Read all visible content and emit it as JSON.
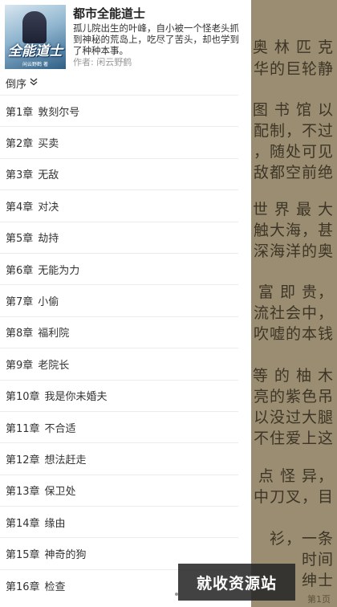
{
  "reader": {
    "lines": [
      "奥 林 匹 克",
      "华的巨轮静",
      "图 书 馆 以",
      "配制，不过",
      "，随处可见",
      "敌都空前绝",
      "世 界 最 大",
      "触大海，甚",
      "深海洋的奥",
      "富 即 贵，",
      "流社会中，",
      "吹嘘的本钱",
      "等 的 柚 木",
      "亮的紫色吊",
      "以没过大腿",
      "不住爱上这",
      "点 怪 异，",
      "中刀叉，目",
      "衫，一条",
      "时间",
      "绅士"
    ],
    "page_num": "第1页"
  },
  "book": {
    "cover_title": "全能道士",
    "cover_sub": "闲云野鹤 著",
    "title": "都市全能道士",
    "description": "孤儿院出生的叶峰，自小被一个怪老头抓到神秘的荒岛上，吃尽了苦头，却也学到了种种本事。",
    "author": "作者: 闲云野鹤"
  },
  "sort": {
    "label": "倒序"
  },
  "chapters": [
    {
      "num": "第1章",
      "title": "敦刻尔号"
    },
    {
      "num": "第2章",
      "title": "买卖"
    },
    {
      "num": "第3章",
      "title": "无敌"
    },
    {
      "num": "第4章",
      "title": "对决"
    },
    {
      "num": "第5章",
      "title": "劫持"
    },
    {
      "num": "第6章",
      "title": "无能为力"
    },
    {
      "num": "第7章",
      "title": "小偷"
    },
    {
      "num": "第8章",
      "title": "福利院"
    },
    {
      "num": "第9章",
      "title": "老院长"
    },
    {
      "num": "第10章",
      "title": "我是你未婚夫"
    },
    {
      "num": "第11章",
      "title": "不合适"
    },
    {
      "num": "第12章",
      "title": "想法赶走"
    },
    {
      "num": "第13章",
      "title": "保卫处"
    },
    {
      "num": "第14章",
      "title": "缘由"
    },
    {
      "num": "第15章",
      "title": "神奇的狗"
    },
    {
      "num": "第16章",
      "title": "检查"
    }
  ],
  "watermark": "就收资源站",
  "icons": {
    "sort": "chevron-double-down-icon"
  },
  "colors": {
    "drawer_bg": "#ffffff",
    "reader_bg": "#c8b898",
    "divider": "#ececec"
  }
}
